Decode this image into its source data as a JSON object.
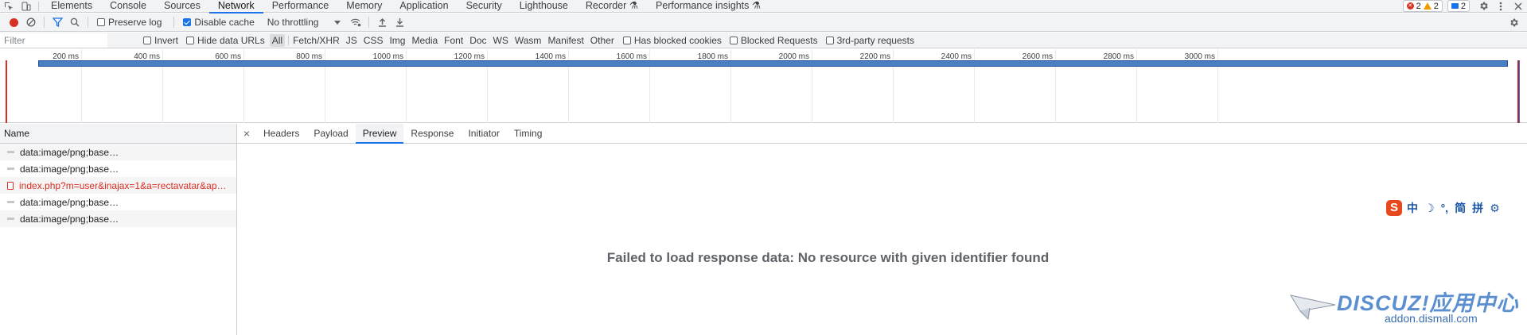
{
  "tabbar": {
    "tabs": [
      {
        "label": "Elements",
        "active": false
      },
      {
        "label": "Console",
        "active": false
      },
      {
        "label": "Sources",
        "active": false
      },
      {
        "label": "Network",
        "active": true
      },
      {
        "label": "Performance",
        "active": false
      },
      {
        "label": "Memory",
        "active": false
      },
      {
        "label": "Application",
        "active": false
      },
      {
        "label": "Security",
        "active": false
      },
      {
        "label": "Lighthouse",
        "active": false
      },
      {
        "label": "Recorder ⚗",
        "active": false
      },
      {
        "label": "Performance insights ⚗",
        "active": false
      }
    ],
    "error_count": "2",
    "warning_count": "2",
    "message_count": "2"
  },
  "toolbar": {
    "preserve_log_label": "Preserve log",
    "preserve_log_checked": false,
    "disable_cache_label": "Disable cache",
    "disable_cache_checked": true,
    "throttling_value": "No throttling"
  },
  "filterbar": {
    "filter_placeholder": "Filter",
    "invert_label": "Invert",
    "hide_data_urls_label": "Hide data URLs",
    "types": [
      "All",
      "Fetch/XHR",
      "JS",
      "CSS",
      "Img",
      "Media",
      "Font",
      "Doc",
      "WS",
      "Wasm",
      "Manifest",
      "Other"
    ],
    "active_type": "All",
    "blocked_cookies_label": "Has blocked cookies",
    "blocked_requests_label": "Blocked Requests",
    "third_party_label": "3rd-party requests"
  },
  "overview": {
    "ticks": [
      "200 ms",
      "400 ms",
      "600 ms",
      "800 ms",
      "1000 ms",
      "1200 ms",
      "1400 ms",
      "1600 ms",
      "1800 ms",
      "2000 ms",
      "2200 ms",
      "2400 ms",
      "2600 ms",
      "2800 ms",
      "3000 ms"
    ]
  },
  "requests": {
    "column_name": "Name",
    "rows": [
      {
        "name": "data:image/png;base…",
        "error": false
      },
      {
        "name": "data:image/png;base…",
        "error": false
      },
      {
        "name": "index.php?m=user&inajax=1&a=rectavatar&ap…",
        "error": true
      },
      {
        "name": "data:image/png;base…",
        "error": false
      },
      {
        "name": "data:image/png;base…",
        "error": false
      }
    ]
  },
  "details": {
    "close_symbol": "×",
    "tabs": [
      {
        "label": "Headers",
        "active": false
      },
      {
        "label": "Payload",
        "active": false
      },
      {
        "label": "Preview",
        "active": true
      },
      {
        "label": "Response",
        "active": false
      },
      {
        "label": "Initiator",
        "active": false
      },
      {
        "label": "Timing",
        "active": false
      }
    ],
    "message": "Failed to load response data: No resource with given identifier found"
  },
  "ime": {
    "logo": "S",
    "items": [
      "中",
      "☽",
      "°,",
      "简",
      "拼",
      "⚙"
    ]
  },
  "watermark": {
    "brand": "DISCUZ!应用中心",
    "url": "addon.dismall.com"
  }
}
